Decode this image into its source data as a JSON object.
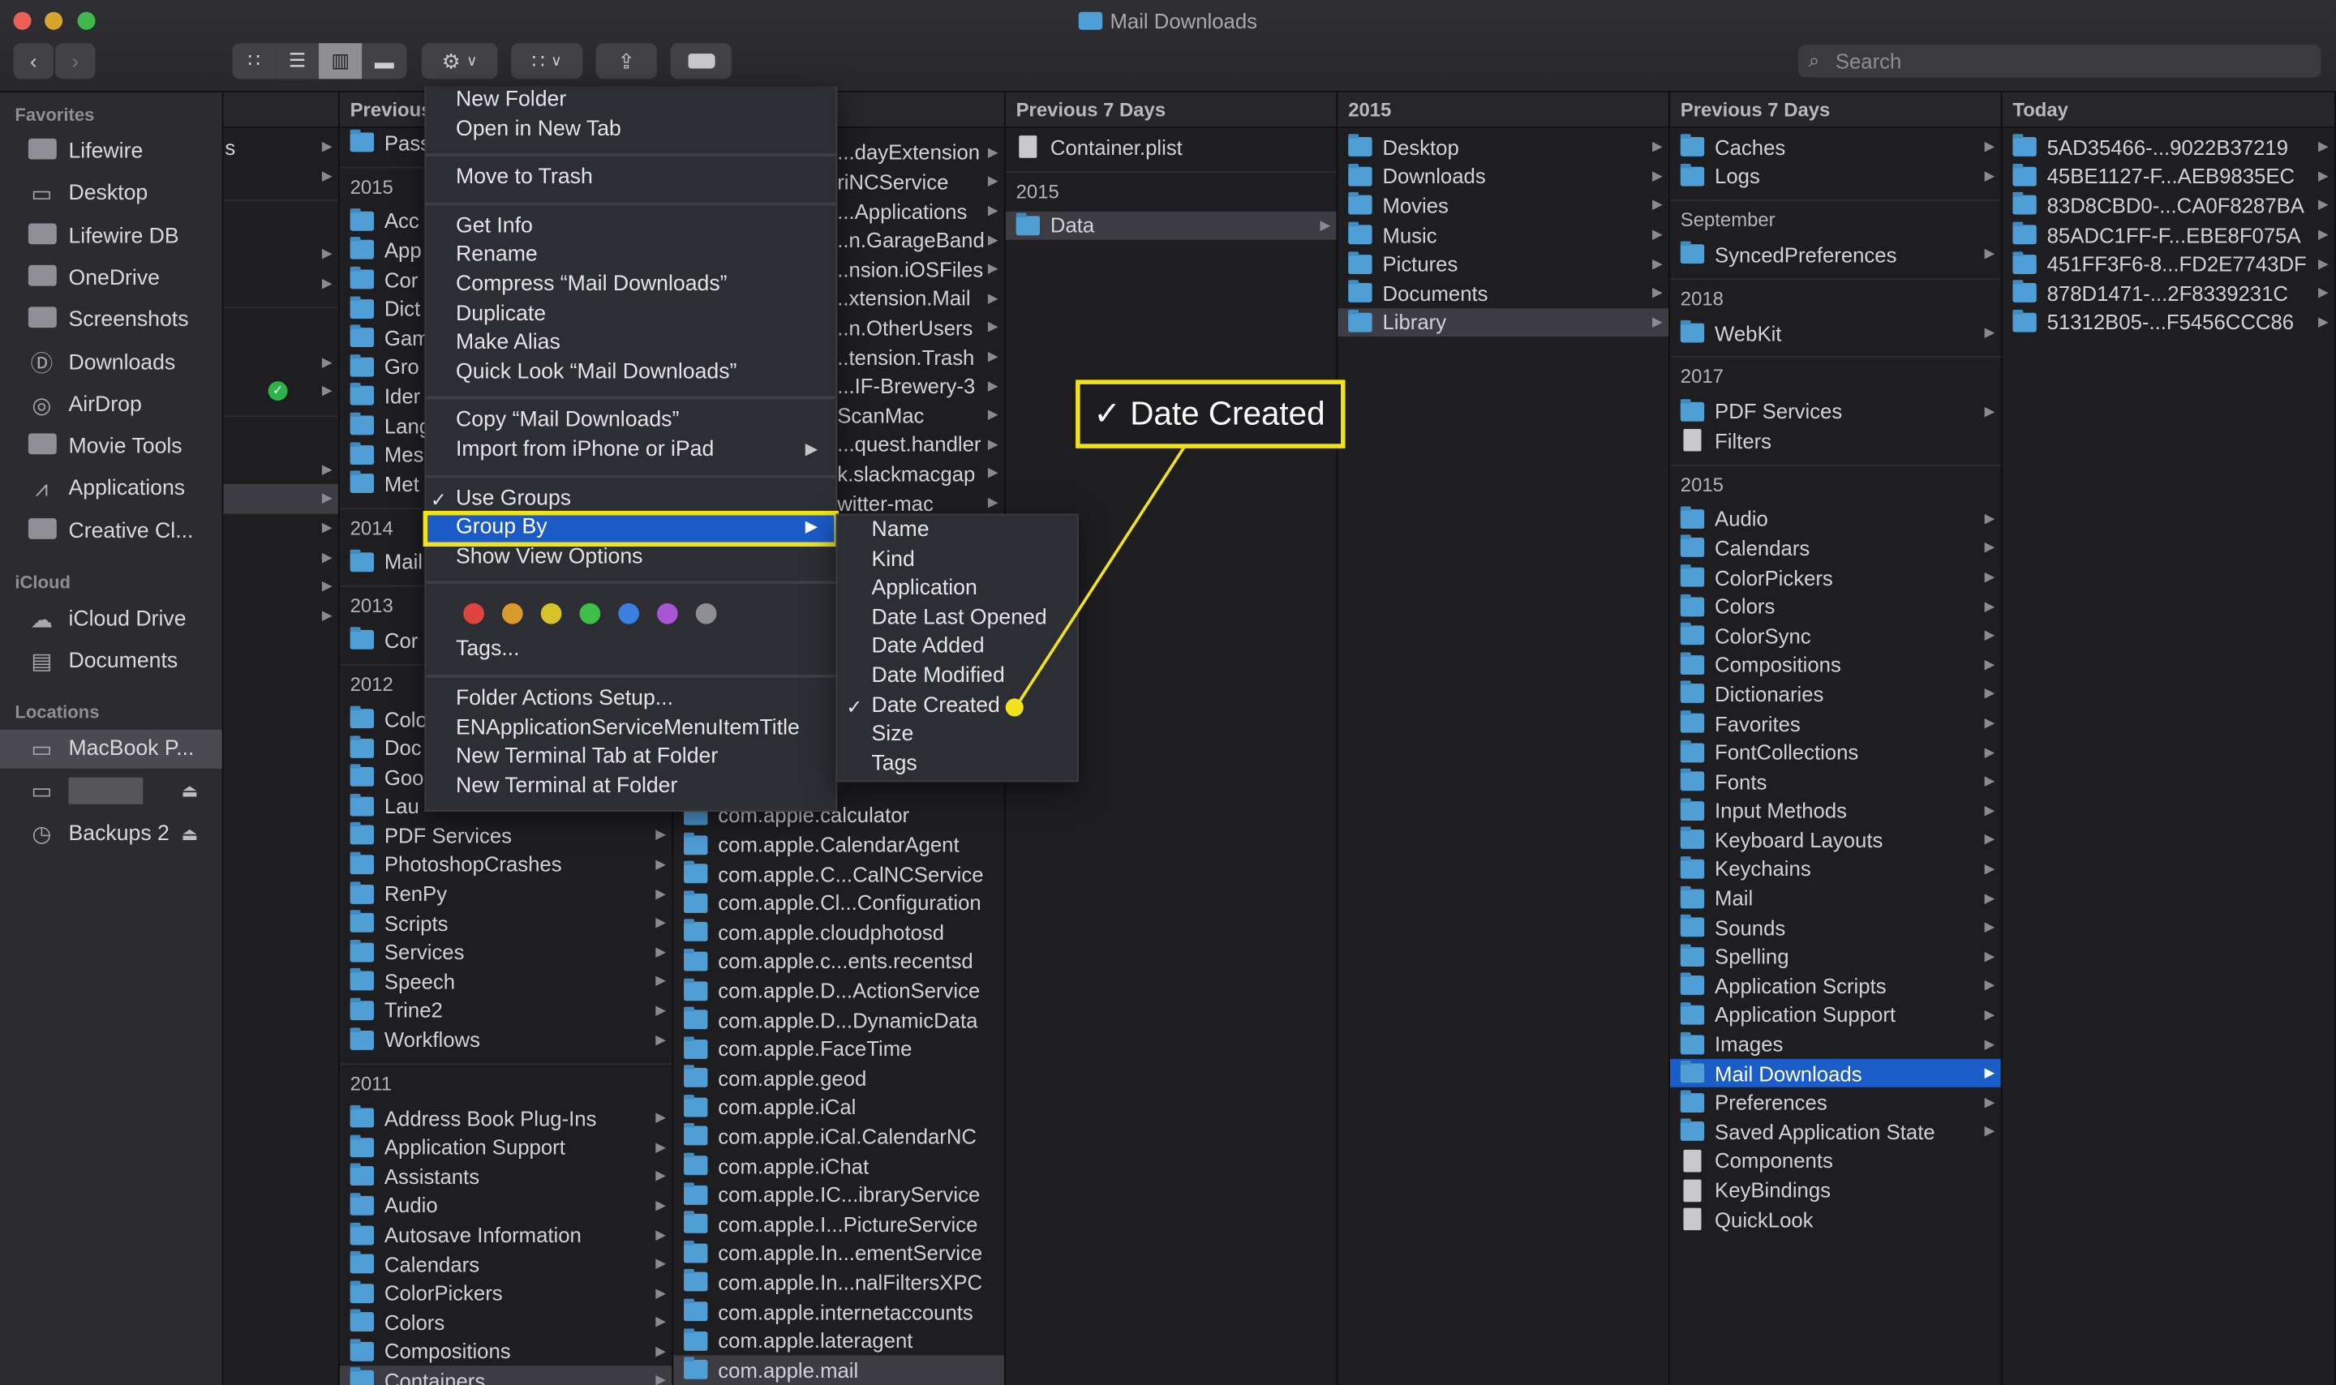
{
  "window": {
    "title": "Mail Downloads"
  },
  "toolbar": {
    "back_icon": "chevron-left-icon",
    "forward_icon": "chevron-right-icon",
    "view_modes": [
      "icon-view",
      "list-view",
      "column-view",
      "gallery-view"
    ],
    "active_view": "column-view",
    "search_placeholder": "Search"
  },
  "sidebar": {
    "sections": [
      {
        "title": "Favorites",
        "items": [
          {
            "label": "Lifewire",
            "icon": "folder"
          },
          {
            "label": "Desktop",
            "icon": "desktop"
          },
          {
            "label": "Lifewire DB",
            "icon": "folder"
          },
          {
            "label": "OneDrive",
            "icon": "folder"
          },
          {
            "label": "Screenshots",
            "icon": "folder"
          },
          {
            "label": "Downloads",
            "icon": "download"
          },
          {
            "label": "AirDrop",
            "icon": "airdrop"
          },
          {
            "label": "Movie Tools",
            "icon": "folder"
          },
          {
            "label": "Applications",
            "icon": "applications"
          },
          {
            "label": "Creative Cl...",
            "icon": "folder"
          }
        ]
      },
      {
        "title": "iCloud",
        "items": [
          {
            "label": "iCloud Drive",
            "icon": "cloud"
          },
          {
            "label": "Documents",
            "icon": "document"
          }
        ]
      },
      {
        "title": "Locations",
        "items": [
          {
            "label": "MacBook P...",
            "icon": "laptop",
            "selected": true
          },
          {
            "label": "",
            "icon": "disk",
            "eject": true,
            "blurred": true
          },
          {
            "label": "Backups 2",
            "icon": "time-machine",
            "eject": true
          }
        ]
      }
    ]
  },
  "columns": [
    {
      "header": "",
      "items": [
        {
          "label": "s",
          "arrow": true
        },
        {
          "arrow": true
        },
        {
          "group": ""
        },
        {
          "arrow": true
        },
        {
          "arrow": true
        },
        {
          "group": ""
        },
        {
          "arrow": true
        },
        {
          "arrow": true,
          "badge": "check"
        },
        {
          "group": ""
        },
        {
          "arrow": true
        },
        {
          "arrow": true,
          "selected": true
        },
        {
          "arrow": true
        },
        {
          "arrow": true
        },
        {
          "arrow": true
        },
        {
          "arrow": true
        }
      ]
    },
    {
      "header": "Previous",
      "items": [
        {
          "label": "Pass",
          "arrow": true
        },
        {
          "group": "2015"
        },
        {
          "label": "Acc"
        },
        {
          "label": "App",
          "arrow": true
        },
        {
          "label": "Cor",
          "arrow": true
        },
        {
          "label": "Dict"
        },
        {
          "label": "Gam"
        },
        {
          "label": "Gro",
          "arrow": true
        },
        {
          "label": "Ider",
          "arrow": true
        },
        {
          "label": "Lang"
        },
        {
          "label": "Mes"
        },
        {
          "label": "Met",
          "arrow": true
        },
        {
          "group": "2014"
        },
        {
          "label": "Mail",
          "arrow": true
        },
        {
          "group": "2013"
        },
        {
          "label": "Cor",
          "arrow": true
        },
        {
          "group": "2012"
        },
        {
          "label": "Colo"
        },
        {
          "label": "Doc"
        },
        {
          "label": "Goo"
        },
        {
          "label": "Lau"
        },
        {
          "label": "PDF Services",
          "arrow": true
        },
        {
          "label": "PhotoshopCrashes",
          "arrow": true
        },
        {
          "label": "RenPy",
          "arrow": true
        },
        {
          "label": "Scripts",
          "arrow": true
        },
        {
          "label": "Services",
          "arrow": true
        },
        {
          "label": "Speech",
          "arrow": true
        },
        {
          "label": "Trine2",
          "arrow": true
        },
        {
          "label": "Workflows",
          "arrow": true
        },
        {
          "group": "2011"
        },
        {
          "label": "Address Book Plug-Ins",
          "arrow": true
        },
        {
          "label": "Application Support",
          "arrow": true
        },
        {
          "label": "Assistants",
          "arrow": true
        },
        {
          "label": "Audio",
          "arrow": true
        },
        {
          "label": "Autosave Information",
          "arrow": true
        },
        {
          "label": "Calendars",
          "arrow": true
        },
        {
          "label": "ColorPickers",
          "arrow": true
        },
        {
          "label": "Colors",
          "arrow": true
        },
        {
          "label": "Compositions",
          "arrow": true
        },
        {
          "label": "Containers",
          "arrow": true,
          "selected": true
        }
      ]
    },
    {
      "header": "",
      "items_top": [
        "...dayExtension",
        "riNCService",
        "...Applications",
        "..n.GarageBand",
        "..nsion.iOSFiles",
        "..xtension.Mail",
        "..n.OtherUsers",
        "..tension.Trash",
        "...IF-Brewery-3",
        "ScanMac",
        "...quest.handler",
        "k.slackmacgap",
        "witter-mac"
      ],
      "items_bottom": [
        {
          "label": "com.apple.calculator"
        },
        {
          "label": "com.apple.CalendarAgent"
        },
        {
          "label": "com.apple.C...CalNCService"
        },
        {
          "label": "com.apple.Cl...Configuration"
        },
        {
          "label": "com.apple.cloudphotosd"
        },
        {
          "label": "com.apple.c...ents.recentsd"
        },
        {
          "label": "com.apple.D...ActionService"
        },
        {
          "label": "com.apple.D...DynamicData"
        },
        {
          "label": "com.apple.FaceTime"
        },
        {
          "label": "com.apple.geod"
        },
        {
          "label": "com.apple.iCal"
        },
        {
          "label": "com.apple.iCal.CalendarNC"
        },
        {
          "label": "com.apple.iChat"
        },
        {
          "label": "com.apple.IC...ibraryService"
        },
        {
          "label": "com.apple.I...PictureService"
        },
        {
          "label": "com.apple.In...ementService"
        },
        {
          "label": "com.apple.In...nalFiltersXPC"
        },
        {
          "label": "com.apple.internetaccounts"
        },
        {
          "label": "com.apple.lateragent"
        },
        {
          "label": "com.apple.mail",
          "selected": true
        }
      ]
    },
    {
      "header": "Previous 7 Days",
      "items": [
        {
          "label": "Container.plist",
          "file": true
        },
        {
          "group": "2015"
        },
        {
          "label": "Data",
          "arrow": true,
          "selected": true
        }
      ]
    },
    {
      "header": "2015",
      "items": [
        {
          "label": "Desktop",
          "arrow": true
        },
        {
          "label": "Downloads",
          "arrow": true
        },
        {
          "label": "Movies",
          "arrow": true
        },
        {
          "label": "Music",
          "arrow": true
        },
        {
          "label": "Pictures",
          "arrow": true
        },
        {
          "label": "Documents",
          "arrow": true
        },
        {
          "label": "Library",
          "arrow": true,
          "selected": true
        }
      ]
    },
    {
      "header": "Previous 7 Days",
      "items": [
        {
          "label": "Caches",
          "arrow": true
        },
        {
          "label": "Logs",
          "arrow": true
        },
        {
          "group": "September"
        },
        {
          "label": "SyncedPreferences",
          "arrow": true
        },
        {
          "group": "2018"
        },
        {
          "label": "WebKit",
          "arrow": true
        },
        {
          "group": "2017"
        },
        {
          "label": "PDF Services",
          "arrow": true
        },
        {
          "label": "Filters",
          "file": true
        },
        {
          "group": "2015"
        },
        {
          "label": "Audio",
          "arrow": true
        },
        {
          "label": "Calendars",
          "arrow": true
        },
        {
          "label": "ColorPickers",
          "arrow": true
        },
        {
          "label": "Colors",
          "arrow": true
        },
        {
          "label": "ColorSync",
          "arrow": true
        },
        {
          "label": "Compositions",
          "arrow": true
        },
        {
          "label": "Dictionaries",
          "arrow": true
        },
        {
          "label": "Favorites",
          "arrow": true
        },
        {
          "label": "FontCollections",
          "arrow": true
        },
        {
          "label": "Fonts",
          "arrow": true
        },
        {
          "label": "Input Methods",
          "arrow": true
        },
        {
          "label": "Keyboard Layouts",
          "arrow": true
        },
        {
          "label": "Keychains",
          "arrow": true
        },
        {
          "label": "Mail",
          "arrow": true
        },
        {
          "label": "Sounds",
          "arrow": true
        },
        {
          "label": "Spelling",
          "arrow": true
        },
        {
          "label": "Application Scripts",
          "arrow": true
        },
        {
          "label": "Application Support",
          "arrow": true
        },
        {
          "label": "Images",
          "arrow": true
        },
        {
          "label": "Mail Downloads",
          "arrow": true,
          "active": true
        },
        {
          "label": "Preferences",
          "arrow": true
        },
        {
          "label": "Saved Application State",
          "arrow": true
        },
        {
          "label": "Components",
          "file": true
        },
        {
          "label": "KeyBindings",
          "file": true
        },
        {
          "label": "QuickLook",
          "file": true
        }
      ]
    },
    {
      "header": "Today",
      "items": [
        {
          "label": "5AD35466-...9022B37219",
          "arrow": true
        },
        {
          "label": "45BE1127-F...AEB9835EC",
          "arrow": true
        },
        {
          "label": "83D8CBD0-...CA0F8287BA",
          "arrow": true
        },
        {
          "label": "85ADC1FF-F...EBE8F075A",
          "arrow": true
        },
        {
          "label": "451FF3F6-8...FD2E7743DF",
          "arrow": true
        },
        {
          "label": "878D1471-...2F8339231C",
          "arrow": true
        },
        {
          "label": "51312B05-...F5456CCC86",
          "arrow": true
        }
      ]
    }
  ],
  "context_menu": {
    "items": [
      {
        "label": "New Folder"
      },
      {
        "label": "Open in New Tab"
      },
      {
        "sep": true
      },
      {
        "label": "Move to Trash"
      },
      {
        "sep": true
      },
      {
        "label": "Get Info"
      },
      {
        "label": "Rename"
      },
      {
        "label": "Compress “Mail Downloads”"
      },
      {
        "label": "Duplicate"
      },
      {
        "label": "Make Alias"
      },
      {
        "label": "Quick Look “Mail Downloads”"
      },
      {
        "sep": true
      },
      {
        "label": "Copy “Mail Downloads”"
      },
      {
        "label": "Import from iPhone or iPad",
        "submenu": true
      },
      {
        "sep": true
      },
      {
        "label": "Use Groups",
        "checked": true
      },
      {
        "label": "Group By",
        "submenu": true,
        "highlighted": true
      },
      {
        "label": "Show View Options"
      },
      {
        "sep": true
      },
      {
        "colors": true
      },
      {
        "label": "Tags..."
      },
      {
        "sep": true
      },
      {
        "label": "Folder Actions Setup..."
      },
      {
        "label": "ENApplicationServiceMenuItemTitle"
      },
      {
        "label": "New Terminal Tab at Folder"
      },
      {
        "label": "New Terminal at Folder"
      }
    ],
    "tag_colors": [
      "#e0443e",
      "#d99a2b",
      "#d6c22a",
      "#3fbf4a",
      "#3b7fe0",
      "#a855d6",
      "#8e8e93"
    ]
  },
  "group_by_submenu": {
    "items": [
      {
        "label": "Name"
      },
      {
        "label": "Kind"
      },
      {
        "label": "Application"
      },
      {
        "label": "Date Last Opened"
      },
      {
        "label": "Date Added"
      },
      {
        "label": "Date Modified"
      },
      {
        "label": "Date Created",
        "checked": true
      },
      {
        "label": "Size"
      },
      {
        "label": "Tags"
      }
    ]
  },
  "callout": {
    "check": "✓",
    "label": "Date Created",
    "color": "#f2e21b"
  }
}
